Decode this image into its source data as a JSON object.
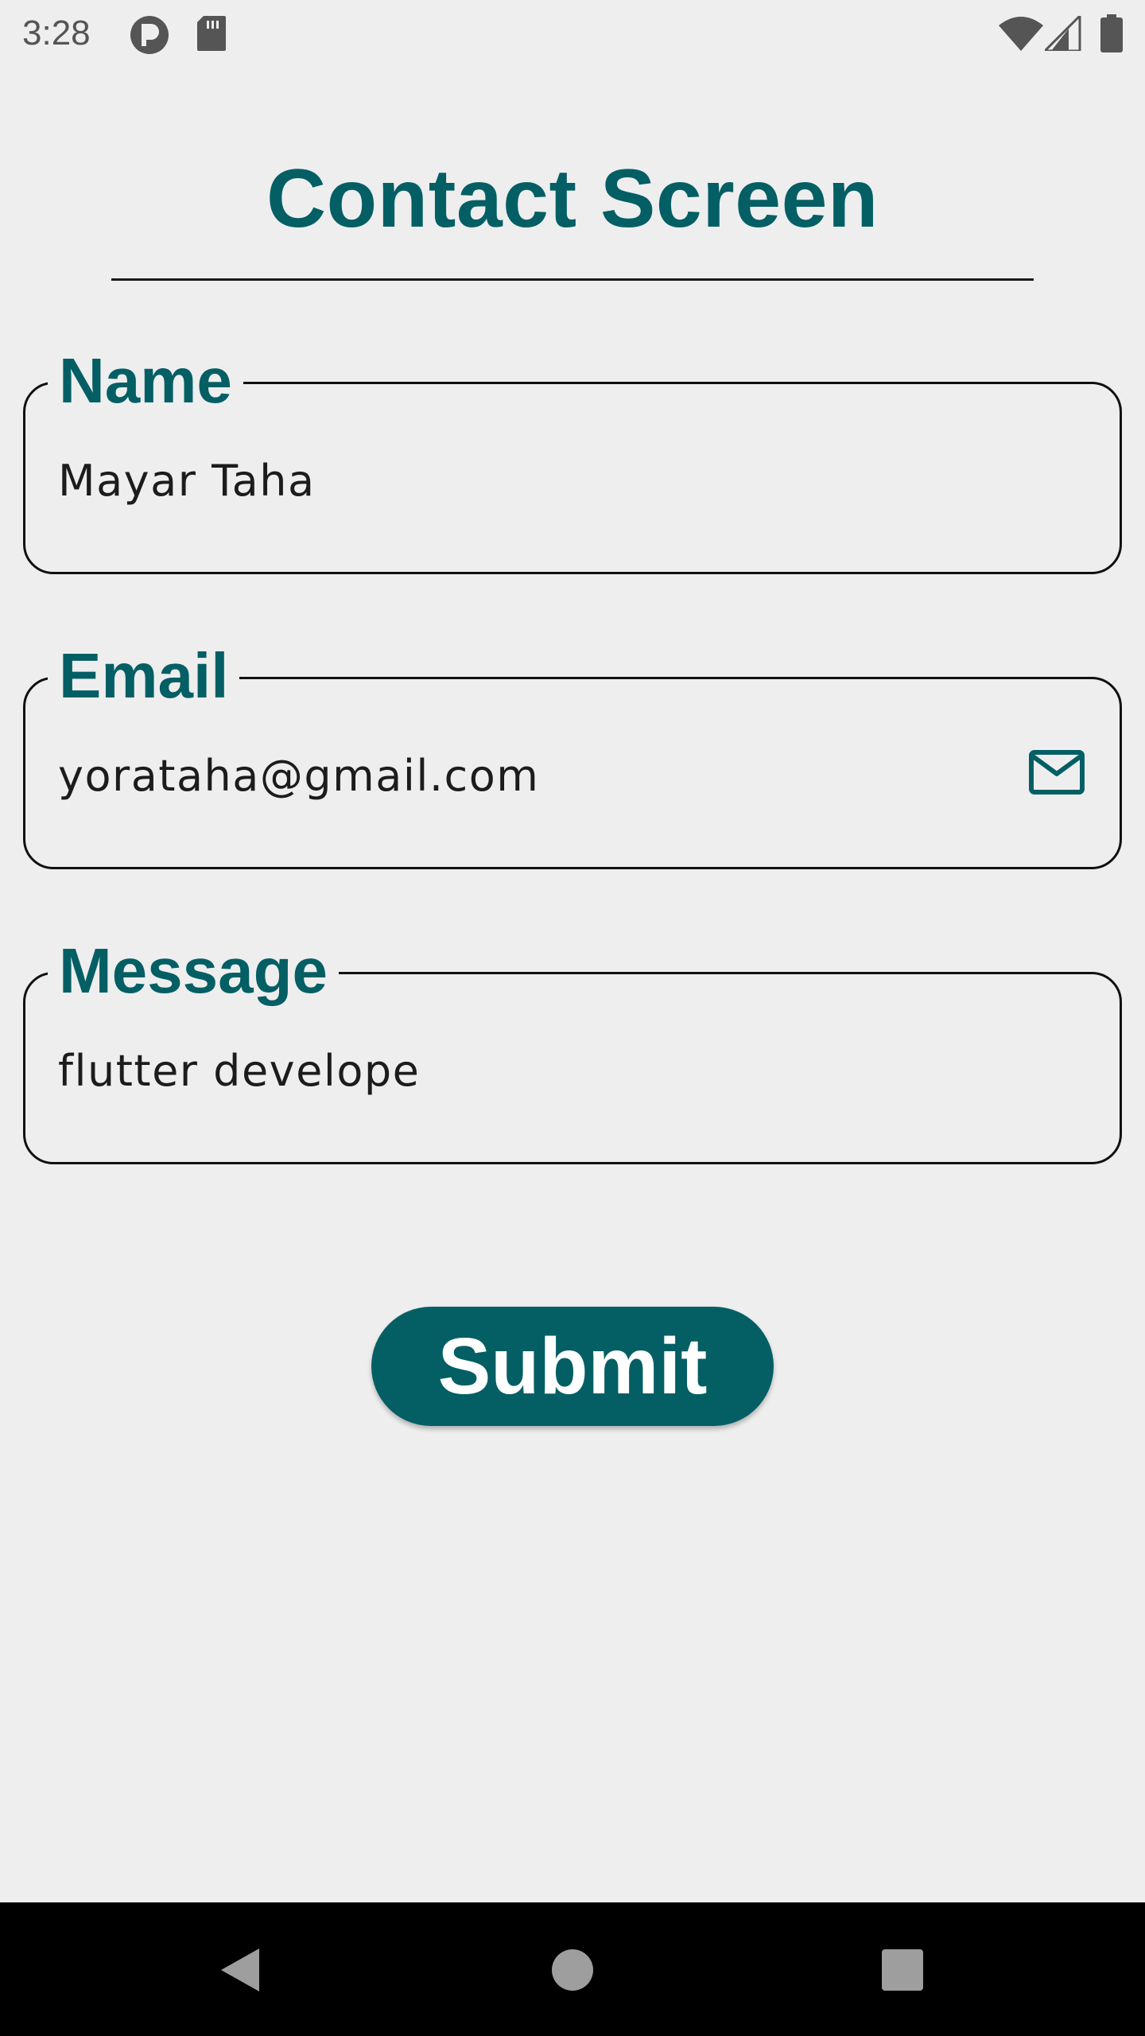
{
  "status_bar": {
    "time": "3:28",
    "icons": [
      "app-notification-icon",
      "sd-card-icon",
      "wifi-icon",
      "cell-signal-icon",
      "battery-icon"
    ]
  },
  "page": {
    "title": "Contact Screen"
  },
  "form": {
    "name": {
      "label": "Name",
      "value": "Mayar Taha"
    },
    "email": {
      "label": "Email",
      "value": "yorataha@gmail.com",
      "icon": "mail-icon"
    },
    "message": {
      "label": "Message",
      "value": "flutter develope"
    },
    "submit_label": "Submit"
  },
  "nav_bar": {
    "icons": [
      "back-icon",
      "home-icon",
      "recents-icon"
    ]
  },
  "colors": {
    "accent": "#045f65",
    "background": "#eeeeee",
    "nav_background": "#000000"
  }
}
